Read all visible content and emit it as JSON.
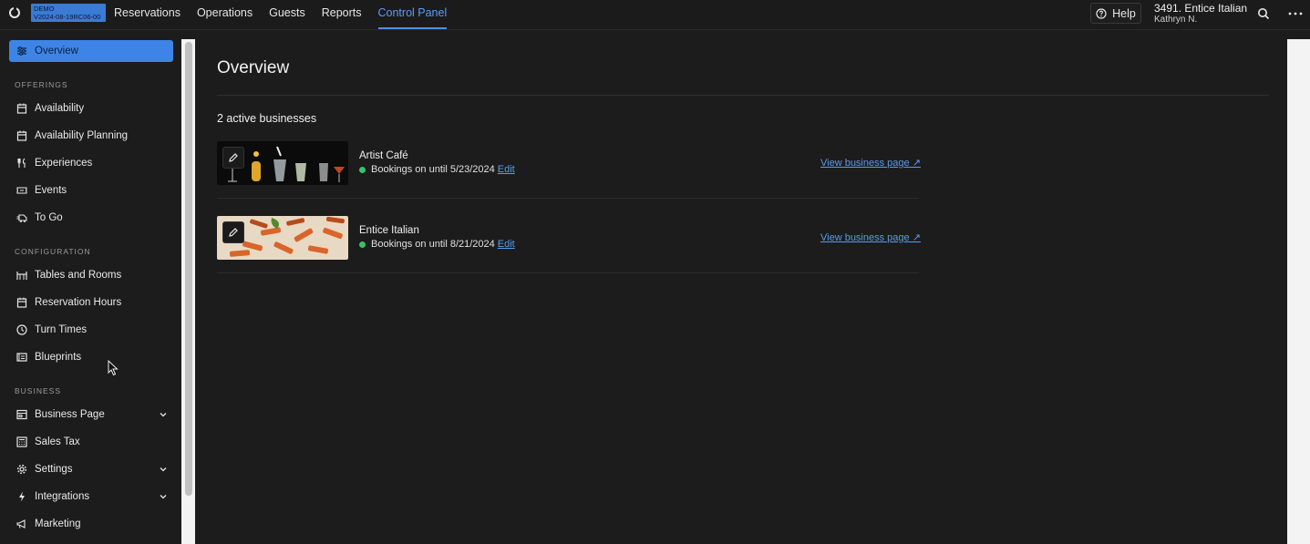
{
  "demo_badge": {
    "line1": "DEMO",
    "line2": "V2024-08-19RC06-00"
  },
  "topnav": [
    {
      "label": "Reservations"
    },
    {
      "label": "Operations"
    },
    {
      "label": "Guests"
    },
    {
      "label": "Reports"
    },
    {
      "label": "Control Panel",
      "active": true
    }
  ],
  "help": {
    "label": "Help"
  },
  "venue": {
    "name": "3491. Entice Italian",
    "user": "Kathryn N."
  },
  "sidebar": {
    "overview": "Overview",
    "sections": {
      "offerings": "OFFERINGS",
      "configuration": "CONFIGURATION",
      "business": "BUSINESS"
    },
    "offerings": [
      {
        "label": "Availability",
        "icon": "calendar-icon"
      },
      {
        "label": "Availability Planning",
        "icon": "calendar-icon"
      },
      {
        "label": "Experiences",
        "icon": "utensils-icon"
      },
      {
        "label": "Events",
        "icon": "ticket-icon"
      },
      {
        "label": "To Go",
        "icon": "delivery-icon"
      }
    ],
    "configuration": [
      {
        "label": "Tables and Rooms",
        "icon": "tables-icon"
      },
      {
        "label": "Reservation Hours",
        "icon": "calendar-icon"
      },
      {
        "label": "Turn Times",
        "icon": "clock-icon"
      },
      {
        "label": "Blueprints",
        "icon": "blueprint-icon"
      }
    ],
    "business": [
      {
        "label": "Business Page",
        "icon": "storefront-icon",
        "expandable": true
      },
      {
        "label": "Sales Tax",
        "icon": "calculator-icon",
        "expandable": false
      },
      {
        "label": "Settings",
        "icon": "gear-icon",
        "expandable": true
      },
      {
        "label": "Integrations",
        "icon": "bolt-icon",
        "expandable": true
      },
      {
        "label": "Marketing",
        "icon": "megaphone-icon",
        "expandable": false
      }
    ]
  },
  "main": {
    "title": "Overview",
    "count": "2 active businesses",
    "businesses": [
      {
        "name": "Artist Café",
        "status": "Bookings on until 5/23/2024",
        "edit": "Edit",
        "view": "View business page ↗"
      },
      {
        "name": "Entice Italian",
        "status": "Bookings on until 8/21/2024",
        "edit": "Edit",
        "view": "View business page ↗"
      }
    ]
  },
  "colors": {
    "accent": "#3d84e6",
    "link": "#5a9bf0",
    "status_ok": "#35c36a",
    "background": "#1c1c1c"
  }
}
